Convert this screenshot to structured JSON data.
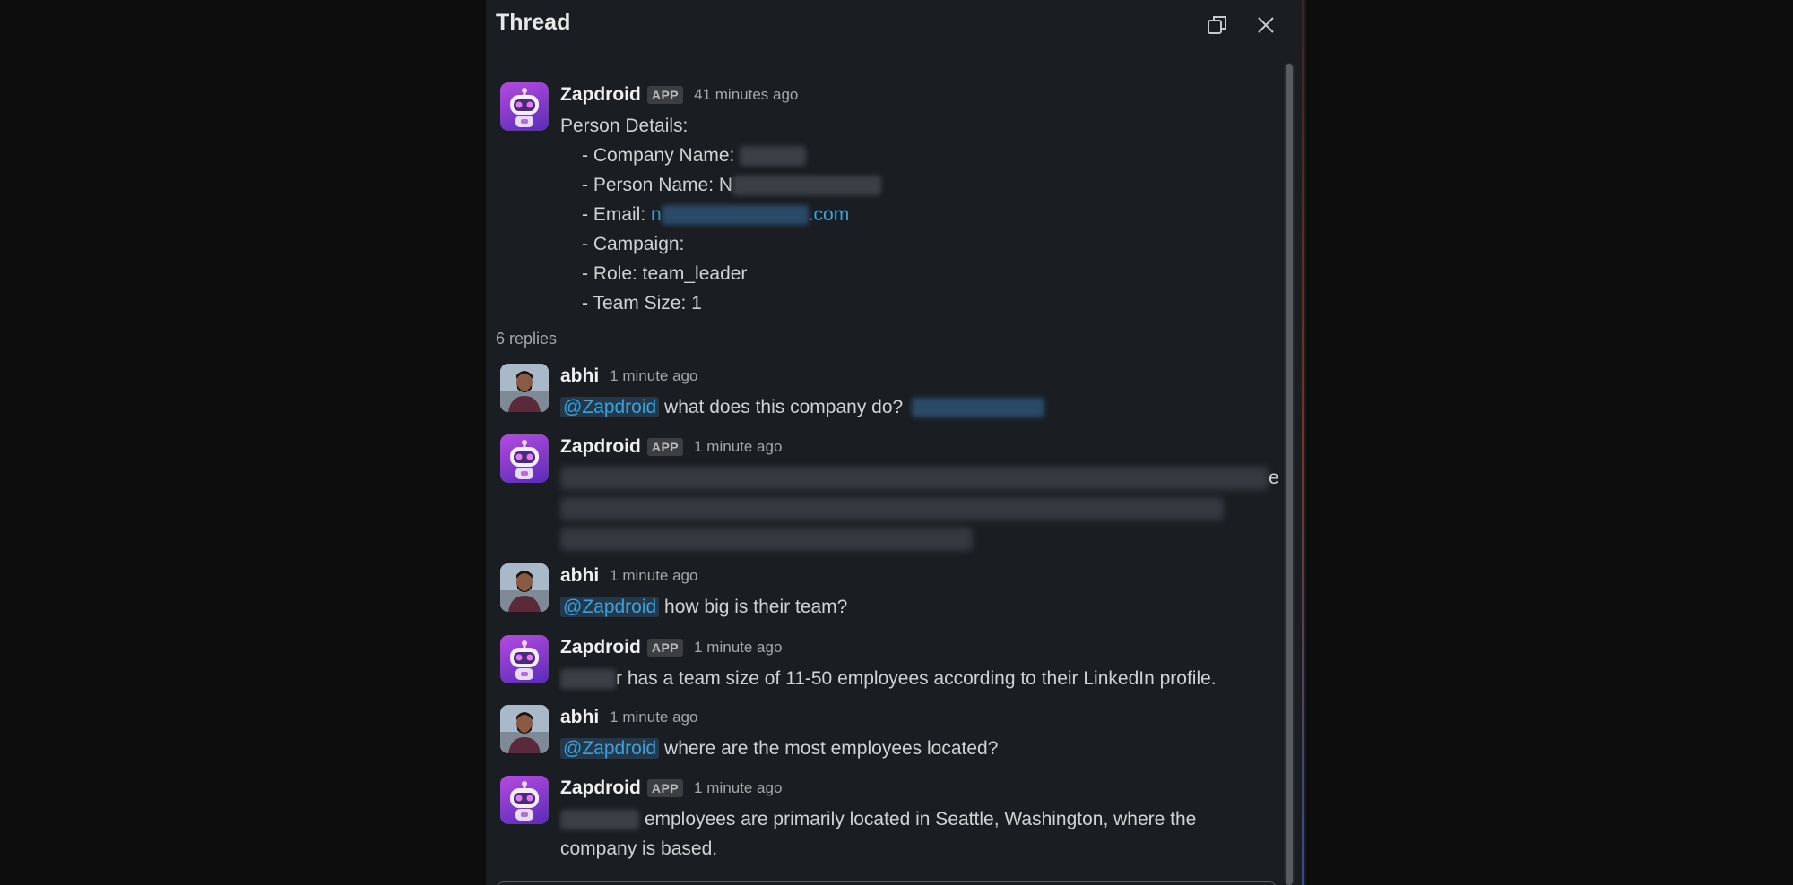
{
  "header": {
    "title": "Thread",
    "popout_icon": "popout-icon",
    "close_icon": "close-icon"
  },
  "parent_message": {
    "author": "Zapdroid",
    "badge": "APP",
    "time": "41 minutes ago",
    "heading": "Person Details:",
    "company_label": "- Company Name: ",
    "person_label": "- Person Name: N",
    "email_label": "- Email: ",
    "email_start": "n",
    "email_end": ".com",
    "campaign_label": "- Campaign:",
    "role_label": "- Role: team_leader",
    "team_label": "- Team Size: 1"
  },
  "replies_label": "6 replies",
  "replies": [
    {
      "author": "abhi",
      "time": "1 minute ago",
      "mention": "@Zapdroid",
      "text": " what does this company  do?"
    },
    {
      "author": "Zapdroid",
      "badge": "APP",
      "time": "1 minute ago",
      "tail": "e"
    },
    {
      "author": "abhi",
      "time": "1 minute ago",
      "mention": "@Zapdroid",
      "text": " how big is their team?"
    },
    {
      "author": "Zapdroid",
      "badge": "APP",
      "time": "1 minute ago",
      "text": "r has a team size of 11-50 employees according to their LinkedIn profile."
    },
    {
      "author": "abhi",
      "time": "1 minute ago",
      "mention": "@Zapdroid",
      "text": " where are the most employees located?"
    },
    {
      "author": "Zapdroid",
      "badge": "APP",
      "time": "1 minute ago",
      "text_line1": " employees are primarily located in Seattle, Washington, where the",
      "text_line2": "company is based."
    }
  ],
  "colors": {
    "panel_bg": "#1a1d21",
    "link": "#36a3e0",
    "mention_bg": "#25384a",
    "bot_avatar": "#9b3fd6"
  }
}
